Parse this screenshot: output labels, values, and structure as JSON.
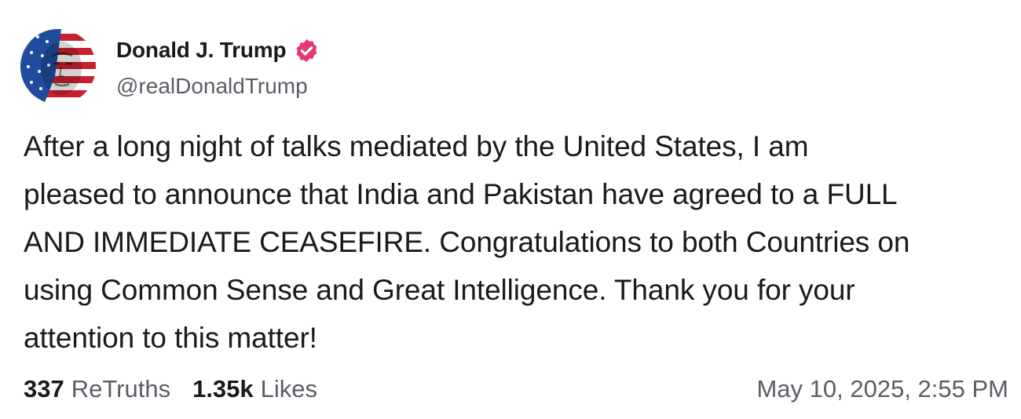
{
  "author": {
    "display_name": "Donald J. Trump",
    "handle": "@realDonaldTrump",
    "verified": true,
    "avatar_icon": "profile-avatar-american-flag-face",
    "verified_icon": "verified-badge-icon",
    "verified_color": "#e5386d"
  },
  "post": {
    "lines": [
      "After a long night of talks mediated by the United States, I am",
      "pleased to announce that India and Pakistan have agreed to a FULL",
      "AND IMMEDIATE CEASEFIRE. Congratulations to both Countries on",
      "using Common Sense and Great Intelligence. Thank you for your",
      "attention to this matter!"
    ]
  },
  "stats": {
    "retruths_count": "337",
    "retruths_label": "ReTruths",
    "likes_count": "1.35k",
    "likes_label": "Likes"
  },
  "timestamp": "May 10, 2025, 2:55 PM"
}
